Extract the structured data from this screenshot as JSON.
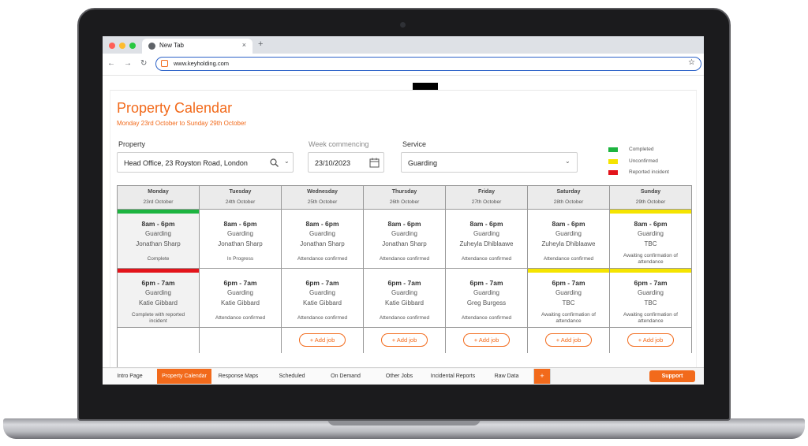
{
  "browser": {
    "tab_title": "New Tab",
    "tab_close": "×",
    "new_tab": "+",
    "url": "www.keyholding.com",
    "back": "←",
    "forward": "→",
    "reload": "↻",
    "bookmark": "☆"
  },
  "page": {
    "title": "Property Calendar",
    "subtitle": "Monday 23rd October to Sunday 29th October"
  },
  "filters": {
    "property_label": "Property",
    "property_value": "Head Office, 23 Royston Road, London",
    "week_label": "Week commencing",
    "week_value": "23/10/2023",
    "service_label": "Service",
    "service_value": "Guarding"
  },
  "legend": [
    {
      "label": "Completed",
      "color": "#1db440"
    },
    {
      "label": "Unconfirmed",
      "color": "#f5e400"
    },
    {
      "label": "Reported incident",
      "color": "#e3141b"
    }
  ],
  "days": [
    {
      "name": "Monday",
      "date": "23rd October"
    },
    {
      "name": "Tuesday",
      "date": "24th October"
    },
    {
      "name": "Wednesday",
      "date": "25th October"
    },
    {
      "name": "Thursday",
      "date": "26th October"
    },
    {
      "name": "Friday",
      "date": "27th October"
    },
    {
      "name": "Saturday",
      "date": "28th October"
    },
    {
      "name": "Sunday",
      "date": "29th October"
    }
  ],
  "shifts_day": [
    {
      "time": "8am - 6pm",
      "service": "Guarding",
      "person": "Jonathan Sharp",
      "status": "Complete"
    },
    {
      "time": "8am - 6pm",
      "service": "Guarding",
      "person": "Jonathan Sharp",
      "status": "In Progress"
    },
    {
      "time": "8am - 6pm",
      "service": "Guarding",
      "person": "Jonathan Sharp",
      "status": "Attendance confirmed"
    },
    {
      "time": "8am - 6pm",
      "service": "Guarding",
      "person": "Jonathan Sharp",
      "status": "Attendance confirmed"
    },
    {
      "time": "8am - 6pm",
      "service": "Guarding",
      "person": "Zuheyla Dhiblaawe",
      "status": "Attendance confirmed"
    },
    {
      "time": "8am - 6pm",
      "service": "Guarding",
      "person": "Zuheyla Dhiblaawe",
      "status": "Attendance confirmed"
    },
    {
      "time": "8am - 6pm",
      "service": "Guarding",
      "person": "TBC",
      "status": "Awaiting confirmation of attendance"
    }
  ],
  "shifts_night": [
    {
      "time": "6pm - 7am",
      "service": "Guarding",
      "person": "Katie Gibbard",
      "status": "Complete with reported incident"
    },
    {
      "time": "6pm - 7am",
      "service": "Guarding",
      "person": "Katie Gibbard",
      "status": "Attendance confirmed"
    },
    {
      "time": "6pm - 7am",
      "service": "Guarding",
      "person": "Katie Gibbard",
      "status": "Attendance confirmed"
    },
    {
      "time": "6pm - 7am",
      "service": "Guarding",
      "person": "Katie Gibbard",
      "status": "Attendance confirmed"
    },
    {
      "time": "6pm - 7am",
      "service": "Guarding",
      "person": "Greg Burgess",
      "status": "Attendance confirmed"
    },
    {
      "time": "6pm - 7am",
      "service": "Guarding",
      "person": "TBC",
      "status": "Awaiting confirmation of attendance"
    },
    {
      "time": "6pm - 7am",
      "service": "Guarding",
      "person": "TBC",
      "status": "Awaiting confirmation of attendance"
    }
  ],
  "add_job_label": "+ Add job",
  "sheets": {
    "intro": "Intro Page",
    "calendar": "Property Calendar",
    "maps": "Response Maps",
    "scheduled": "Scheduled",
    "on_demand": "On Demand",
    "other": "Other Jobs",
    "incidental": "Incidental Reports",
    "raw": "Raw Data",
    "plus": "+",
    "support": "Support"
  },
  "colors": {
    "accent": "#f26a1b",
    "completed": "#1db440",
    "unconfirmed": "#f5e400",
    "incident": "#e3141b"
  }
}
